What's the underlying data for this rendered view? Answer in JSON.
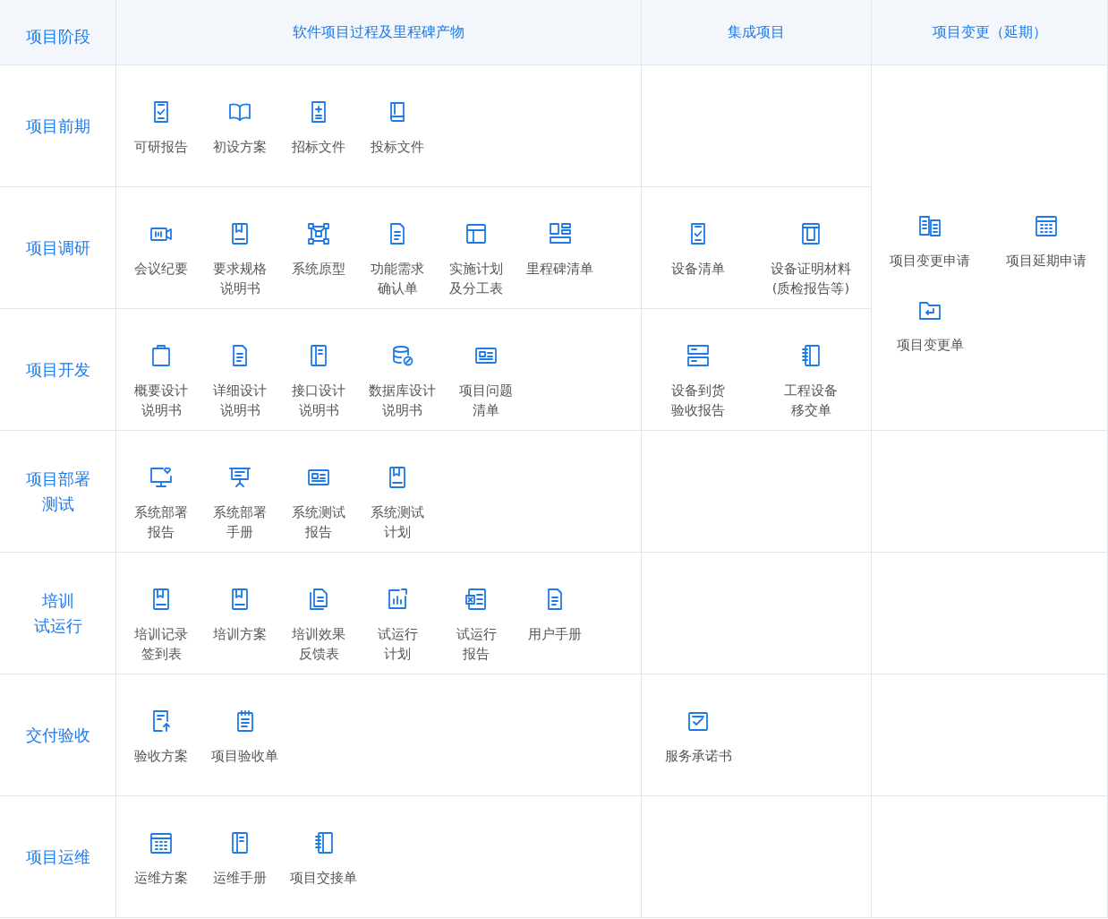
{
  "header": {
    "stage": "项目阶段",
    "software": "软件项目过程及里程碑产物",
    "integration": "集成项目",
    "change": "项目变更（延期）"
  },
  "rows": [
    {
      "stage": [
        "项目前期"
      ],
      "software": [
        [
          "可研报告"
        ],
        [
          "初设方案"
        ],
        [
          "招标文件"
        ],
        [
          "投标文件"
        ]
      ],
      "change": [
        [
          "项目变更申请"
        ],
        [
          "项目延期申请"
        ],
        [
          "项目变更单"
        ]
      ]
    },
    {
      "stage": [
        "项目调研"
      ],
      "software": [
        [
          "会议纪要"
        ],
        [
          "要求规格",
          "说明书"
        ],
        [
          "系统原型"
        ],
        [
          "功能需求",
          "确认单"
        ],
        [
          "实施计划",
          "及分工表"
        ],
        [
          "里程碑清单"
        ]
      ],
      "integration": [
        [
          "设备清单"
        ],
        [
          "设备证明材料",
          "(质检报告等)"
        ]
      ],
      "merged_change": true
    },
    {
      "stage": [
        "项目开发"
      ],
      "software": [
        [
          "概要设计",
          "说明书"
        ],
        [
          "详细设计",
          "说明书"
        ],
        [
          "接口设计",
          "说明书"
        ],
        [
          "数据库设计",
          "说明书"
        ],
        [
          "项目问题",
          "清单"
        ]
      ],
      "integration": [
        [
          "设备到货",
          "验收报告"
        ],
        [
          "工程设备",
          "移交单"
        ]
      ],
      "merged_change": true
    },
    {
      "stage": [
        "项目部署",
        "测试"
      ],
      "software": [
        [
          "系统部署",
          "报告"
        ],
        [
          "系统部署",
          "手册"
        ],
        [
          "系统测试",
          "报告"
        ],
        [
          "系统测试",
          "计划"
        ]
      ]
    },
    {
      "stage": [
        "培训",
        "试运行"
      ],
      "software": [
        [
          "培训记录",
          "签到表"
        ],
        [
          "培训方案"
        ],
        [
          "培训效果",
          "反馈表"
        ],
        [
          "试运行",
          "计划"
        ],
        [
          "试运行",
          "报告"
        ],
        [
          "用户手册"
        ]
      ]
    },
    {
      "stage": [
        "交付验收"
      ],
      "software": [
        [
          "验收方案"
        ],
        [
          "项目验收单"
        ]
      ],
      "integration": [
        [
          "服务承诺书"
        ]
      ]
    },
    {
      "stage": [
        "项目运维"
      ],
      "software": [
        [
          "运维方案"
        ],
        [
          "运维手册"
        ],
        [
          "项目交接单"
        ]
      ]
    }
  ]
}
